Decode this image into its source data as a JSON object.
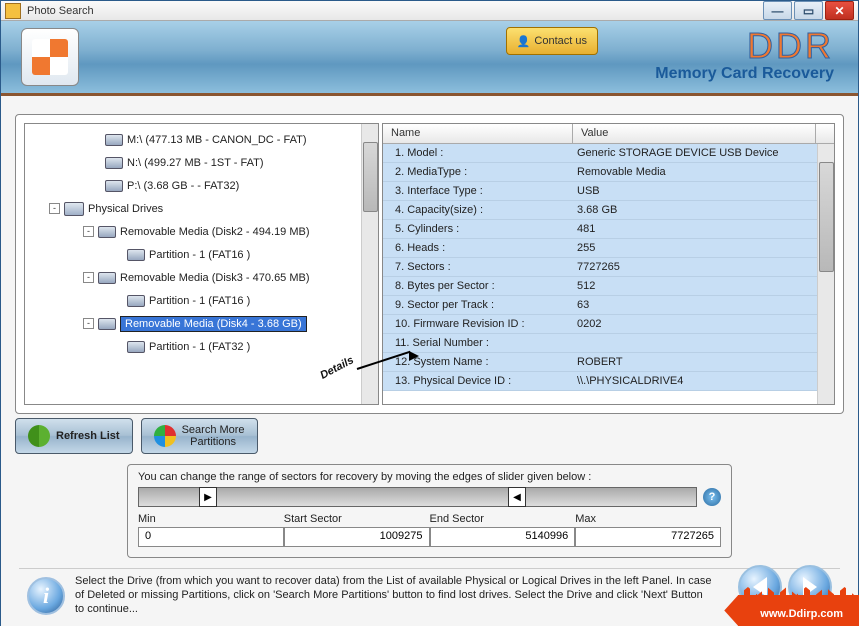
{
  "window": {
    "title": "Photo Search"
  },
  "header": {
    "contact_label": "Contact us",
    "brand": "DDR",
    "brand_sub": "Memory Card Recovery"
  },
  "tree": {
    "items": [
      {
        "indent": 76,
        "toggle": "",
        "icon": "drive",
        "label": "M:\\ (477.13 MB - CANON_DC - FAT)",
        "selected": false
      },
      {
        "indent": 76,
        "toggle": "",
        "icon": "drive",
        "label": "N:\\ (499.27 MB - 1ST - FAT)",
        "selected": false
      },
      {
        "indent": 76,
        "toggle": "",
        "icon": "drive",
        "label": "P:\\ (3.68 GB -  - FAT32)",
        "selected": false
      },
      {
        "indent": 20,
        "toggle": "-",
        "icon": "drives",
        "label": "Physical Drives",
        "selected": false
      },
      {
        "indent": 54,
        "toggle": "-",
        "icon": "drive",
        "label": "Removable Media (Disk2 - 494.19 MB)",
        "selected": false
      },
      {
        "indent": 98,
        "toggle": "",
        "icon": "drive",
        "label": "Partition - 1 (FAT16 )",
        "selected": false
      },
      {
        "indent": 54,
        "toggle": "-",
        "icon": "drive",
        "label": "Removable Media (Disk3 - 470.65 MB)",
        "selected": false
      },
      {
        "indent": 98,
        "toggle": "",
        "icon": "drive",
        "label": "Partition - 1 (FAT16 )",
        "selected": false
      },
      {
        "indent": 54,
        "toggle": "-",
        "icon": "drive",
        "label": "Removable Media (Disk4 - 3.68 GB)",
        "selected": true
      },
      {
        "indent": 98,
        "toggle": "",
        "icon": "drive",
        "label": "Partition - 1 (FAT32 )",
        "selected": false
      }
    ]
  },
  "details_label": "Details",
  "props": {
    "head_name": "Name",
    "head_value": "Value",
    "rows": [
      {
        "n": "1. Model :",
        "v": "Generic STORAGE DEVICE USB Device"
      },
      {
        "n": "2. MediaType :",
        "v": "Removable Media"
      },
      {
        "n": "3. Interface Type :",
        "v": "USB"
      },
      {
        "n": "4. Capacity(size) :",
        "v": "3.68 GB"
      },
      {
        "n": "5. Cylinders :",
        "v": "481"
      },
      {
        "n": "6. Heads :",
        "v": "255"
      },
      {
        "n": "7. Sectors :",
        "v": "7727265"
      },
      {
        "n": "8. Bytes per Sector :",
        "v": "512"
      },
      {
        "n": "9. Sector per Track :",
        "v": "63"
      },
      {
        "n": "10. Firmware Revision ID :",
        "v": "0202"
      },
      {
        "n": "11. Serial Number :",
        "v": ""
      },
      {
        "n": "12. System Name :",
        "v": "ROBERT"
      },
      {
        "n": "13. Physical Device ID :",
        "v": "\\\\.\\PHYSICALDRIVE4"
      }
    ]
  },
  "buttons": {
    "refresh": "Refresh List",
    "search_more": "Search More\nPartitions"
  },
  "range": {
    "hint": "You can change the range of sectors for recovery by moving the edges of slider given below :",
    "min_label": "Min",
    "min_val": "0",
    "start_label": "Start Sector",
    "start_val": "1009275",
    "end_label": "End Sector",
    "end_val": "5140996",
    "max_label": "Max",
    "max_val": "7727265"
  },
  "info": {
    "text": "Select the Drive (from which you want to recover data) from the List of available Physical or Logical Drives in the left Panel. In case of Deleted or missing Partitions, click on 'Search More Partitions' button to find lost drives. Select the Drive and click 'Next' Button to continue..."
  },
  "watermark": "www.Ddirp.com"
}
